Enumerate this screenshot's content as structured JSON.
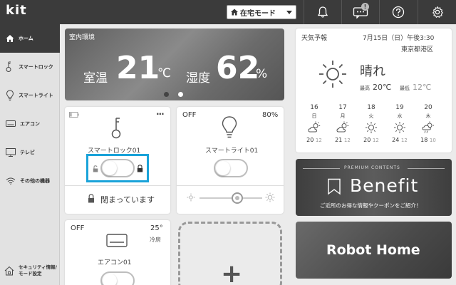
{
  "header": {
    "logo": "kit",
    "mode_label": "在宅モード",
    "chat_badge": "!"
  },
  "sidebar": {
    "items": [
      {
        "label": "ホーム",
        "icon": "home-icon"
      },
      {
        "label": "スマートロック",
        "icon": "key-icon"
      },
      {
        "label": "スマートライト",
        "icon": "bulb-icon"
      },
      {
        "label": "エアコン",
        "icon": "aircon-icon"
      },
      {
        "label": "テレビ",
        "icon": "tv-icon"
      },
      {
        "label": "その他の機器",
        "icon": "wifi-icon"
      }
    ],
    "bottom_line1": "セキュリティ情報/",
    "bottom_line2": "モード設定"
  },
  "environment": {
    "caption": "室内環境",
    "temp_label": "室温",
    "temp_value": "21",
    "temp_unit": "℃",
    "humidity_label": "湿度",
    "humidity_value": "62",
    "humidity_unit": "%"
  },
  "weather": {
    "title": "天気予報",
    "date": "7月15日（日）午後3:30",
    "location": "東京都港区",
    "condition": "晴れ",
    "max_label": "最高",
    "max_value": "20℃",
    "min_label": "最低",
    "min_value": "12℃",
    "forecast": [
      {
        "day": "16",
        "weekday": "日",
        "icon": "partly-cloudy-icon",
        "high": "20",
        "low": "12"
      },
      {
        "day": "17",
        "weekday": "月",
        "icon": "partly-cloudy-icon",
        "high": "21",
        "low": "12"
      },
      {
        "day": "18",
        "weekday": "火",
        "icon": "sunny-icon",
        "high": "20",
        "low": "12"
      },
      {
        "day": "19",
        "weekday": "水",
        "icon": "sunny-icon",
        "high": "24",
        "low": "12"
      },
      {
        "day": "20",
        "weekday": "木",
        "icon": "rain-sun-icon",
        "high": "18",
        "low": "10"
      }
    ]
  },
  "lock_card": {
    "menu": "···",
    "name": "スマートロック01",
    "status": "閉まっています"
  },
  "light_card": {
    "state": "OFF",
    "brightness": "80%",
    "name": "スマートライト01",
    "slider_level": 0.6
  },
  "aircon_card": {
    "state": "OFF",
    "temperature": "25°",
    "mode": "冷房",
    "name": "エアコン01"
  },
  "add_card": {
    "symbol": "+"
  },
  "benefit": {
    "kicker": "PREMIUM CONTENTS",
    "title": "Benefit",
    "description": "ご近所のお得な情報やクーポンをご紹介！"
  },
  "robot": {
    "title": "Robot Home"
  },
  "colors": {
    "topbar": "#3b3b3b",
    "highlight": "#1aa3d9",
    "card": "#ffffff"
  }
}
